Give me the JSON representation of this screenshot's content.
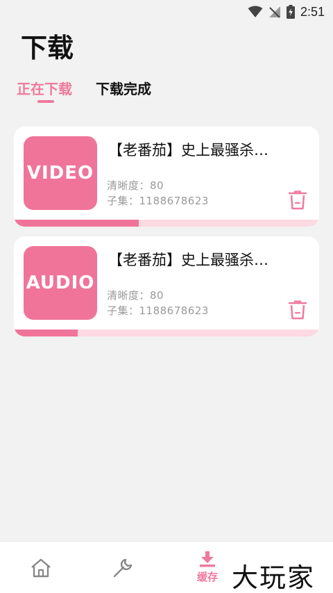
{
  "status_bar": {
    "time": "2:51"
  },
  "page": {
    "title": "下载"
  },
  "tabs": [
    {
      "label": "正在下载",
      "active": true
    },
    {
      "label": "下载完成",
      "active": false
    }
  ],
  "downloads": [
    {
      "thumb_label": "VIDEO",
      "title": "【老番茄】史上最骚杀…",
      "quality": "清晰度：80",
      "episode": "子集：1188678623",
      "progress": 0.41
    },
    {
      "thumb_label": "AUDIO",
      "title": "【老番茄】史上最骚杀…",
      "quality": "清晰度：80",
      "episode": "子集：1188678623",
      "progress": 0.21
    }
  ],
  "bottom_nav": {
    "items": [
      {
        "icon": "home-icon"
      },
      {
        "icon": "wrench-icon"
      },
      {
        "icon": "download-icon",
        "label": "缓存",
        "active": true
      }
    ]
  },
  "watermark": {
    "text": "大玩家"
  },
  "colors": {
    "accent": "#ef7a9d",
    "thumb": "#f07499",
    "track": "#fcd9e3"
  }
}
